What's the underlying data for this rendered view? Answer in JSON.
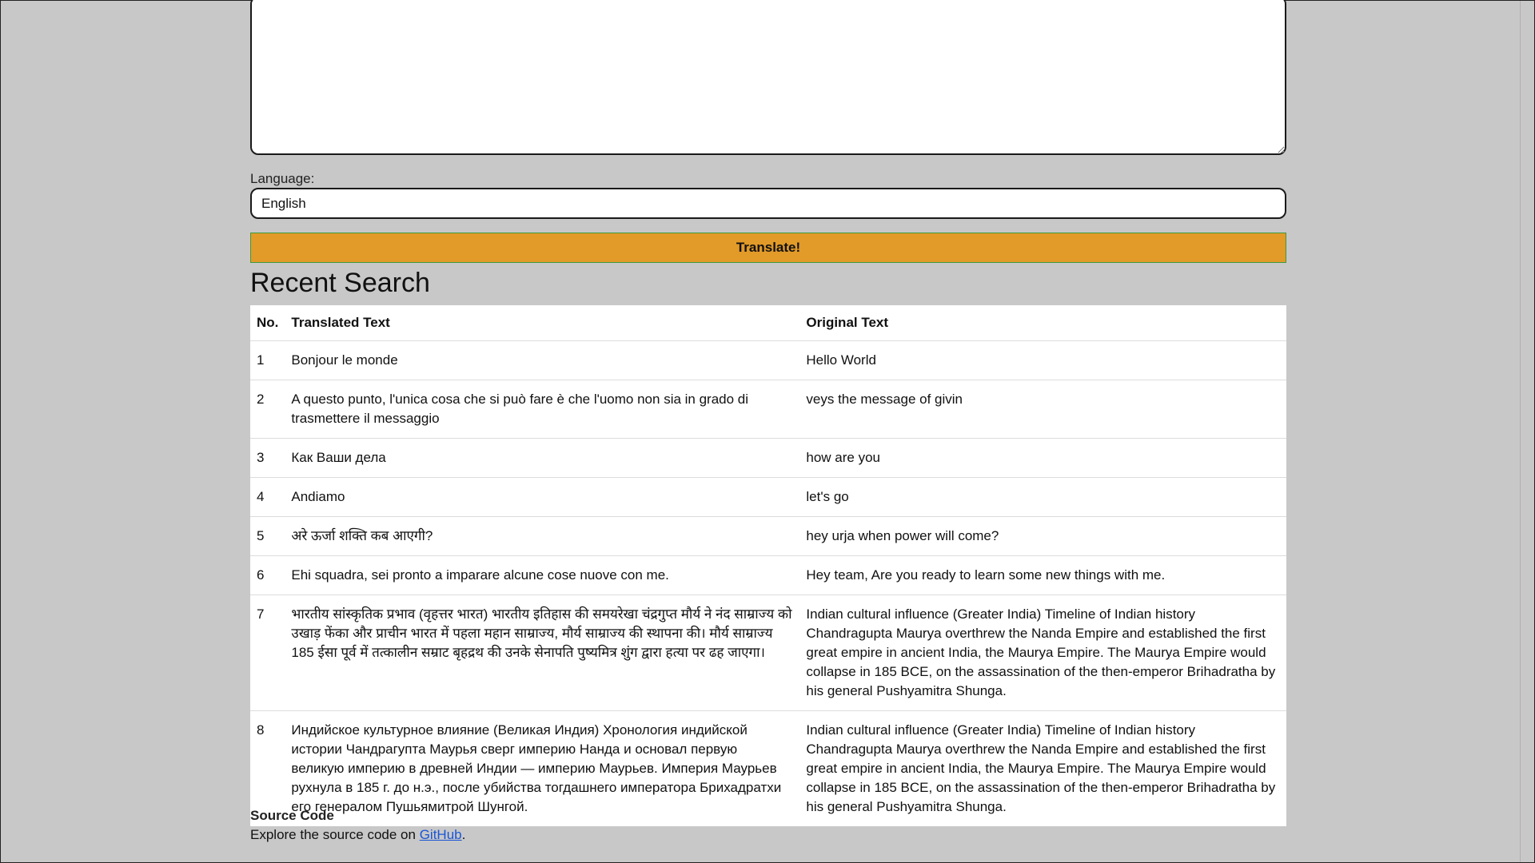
{
  "form": {
    "source_text": "",
    "language_label": "Language:",
    "language_value": "English",
    "translate_label": "Translate!"
  },
  "recent": {
    "title": "Recent Search",
    "headers": {
      "no": "No.",
      "translated": "Translated Text",
      "original": "Original Text"
    },
    "rows": [
      {
        "no": "1",
        "translated": "Bonjour le monde",
        "original": "Hello World"
      },
      {
        "no": "2",
        "translated": "A questo punto, l'unica cosa che si può fare è che l'uomo non sia in grado di trasmettere il messaggio",
        "original": "veys the message of givin"
      },
      {
        "no": "3",
        "translated": "Как Ваши дела",
        "original": "how are you"
      },
      {
        "no": "4",
        "translated": "Andiamo",
        "original": "let's go"
      },
      {
        "no": "5",
        "translated": "अरे ऊर्जा शक्ति कब आएगी?",
        "original": "hey urja when power will come?"
      },
      {
        "no": "6",
        "translated": "Ehi squadra, sei pronto a imparare alcune cose nuove con me.",
        "original": "Hey team, Are you ready to learn some new things with me."
      },
      {
        "no": "7",
        "translated": "भारतीय सांस्कृतिक प्रभाव (वृहत्तर भारत) भारतीय इतिहास की समयरेखा चंद्रगुप्त मौर्य ने नंद साम्राज्य को उखाड़ फेंका और प्राचीन भारत में पहला महान साम्राज्य, मौर्य साम्राज्य की स्थापना की। मौर्य साम्राज्य 185 ईसा पूर्व में तत्कालीन सम्राट बृहद्रथ की उनके सेनापति पुष्यमित्र शुंग द्वारा हत्या पर ढह जाएगा।",
        "original": "Indian cultural influence (Greater India) Timeline of Indian history Chandragupta Maurya overthrew the Nanda Empire and established the first great empire in ancient India, the Maurya Empire. The Maurya Empire would collapse in 185 BCE, on the assassination of the then-emperor Brihadratha by his general Pushyamitra Shunga."
      },
      {
        "no": "8",
        "translated": "Индийское культурное влияние (Великая Индия) Хронология индийской истории Чандрагупта Маурья сверг империю Нанда и основал первую великую империю в древней Индии — империю Маурьев. Империя Маурьев рухнула в 185 г. до н.э., после убийства тогдашнего императора Брихадратхи его генералом Пушьямитрой Шунгой.",
        "original": "Indian cultural influence (Greater India) Timeline of Indian history Chandragupta Maurya overthrew the Nanda Empire and established the first great empire in ancient India, the Maurya Empire. The Maurya Empire would collapse in 185 BCE, on the assassination of the then-emperor Brihadratha by his general Pushyamitra Shunga."
      }
    ]
  },
  "footer": {
    "title": "Source Code",
    "text_before": "Explore the source code on ",
    "link_label": "GitHub",
    "text_after": "."
  },
  "colors": {
    "background": "#c8c8c8",
    "translate_button": "#e29a28",
    "button_border": "#3e9a3e",
    "link": "#1a55d6"
  }
}
